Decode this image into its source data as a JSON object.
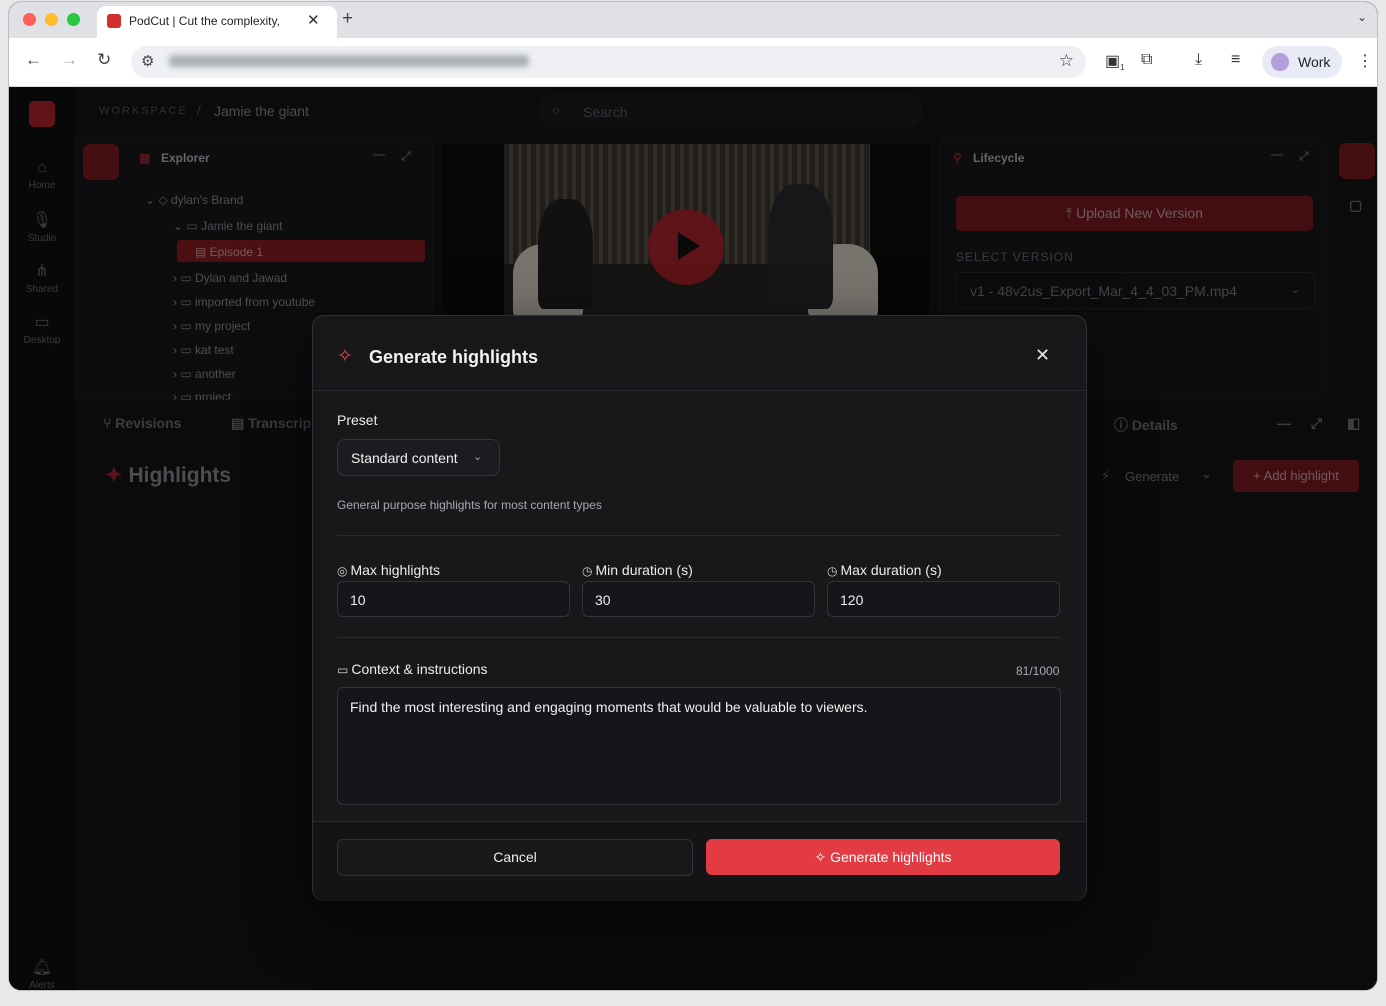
{
  "browser": {
    "tab_title": "PodCut | Cut the complexity,",
    "tab_close": "✕",
    "new_tab": "+",
    "profile": "Work",
    "extension_badge": "1"
  },
  "app": {
    "breadcrumb_root": "WORKSPACE",
    "breadcrumb_sep": "/",
    "breadcrumb_current": "Jamie the giant",
    "search_placeholder": "Search",
    "rail": [
      {
        "label": "Home",
        "icon": "home-icon"
      },
      {
        "label": "Studio",
        "icon": "mic-icon"
      },
      {
        "label": "Shared",
        "icon": "share-icon"
      },
      {
        "label": "Desktop",
        "icon": "desktop-icon"
      },
      {
        "label": "Alerts",
        "icon": "bell-icon"
      }
    ],
    "explorer": {
      "title": "Explorer",
      "tree": [
        "dylan's Brand",
        "Jamie the giant",
        "Episode 1",
        "Dylan and Jawad",
        "imported from youtube",
        "my project",
        "kat test",
        "another",
        "project"
      ]
    },
    "lifecycle": {
      "title": "Lifecycle",
      "upload_label": "Upload New Version",
      "select_version_label": "SELECT VERSION",
      "selected_version": "v1 - 48v2us_Export_Mar_4_4_03_PM.mp4"
    },
    "bottom_tabs": {
      "revisions": "Revisions",
      "transcript": "Transcrip",
      "details": "Details"
    },
    "highlights_title": "Highlights",
    "generate_label": "Generate",
    "add_highlight_label": "Add highlight"
  },
  "modal": {
    "title": "Generate highlights",
    "preset_label": "Preset",
    "preset_value": "Standard content",
    "preset_description": "General purpose highlights for most content types",
    "max_highlights_label": "Max highlights",
    "max_highlights_value": "10",
    "min_duration_label": "Min duration (s)",
    "min_duration_value": "30",
    "max_duration_label": "Max duration (s)",
    "max_duration_value": "120",
    "context_label": "Context & instructions",
    "context_counter": "81/1000",
    "context_value": "Find the most interesting and engaging moments that would be valuable to viewers.",
    "cancel_label": "Cancel",
    "submit_label": "Generate highlights"
  },
  "colors": {
    "accent": "#e23b44",
    "accent_dim": "#7a1a1f",
    "background": "#141417"
  }
}
